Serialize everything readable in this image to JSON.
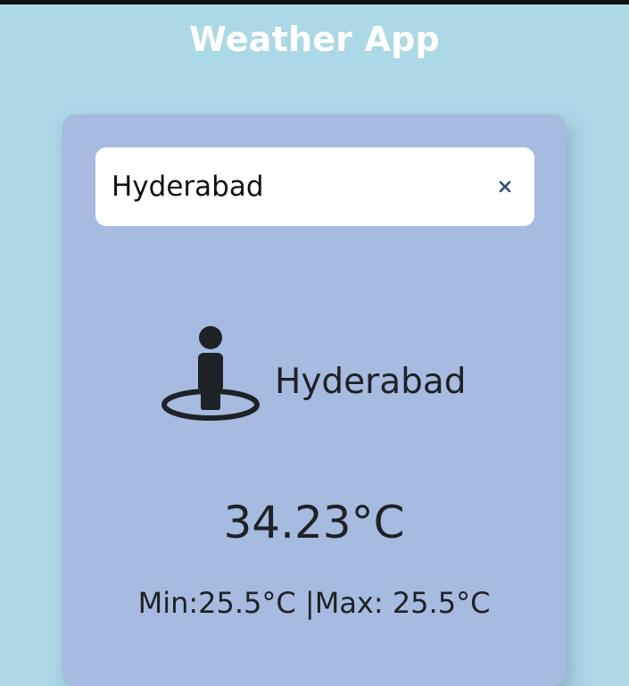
{
  "app": {
    "title": "Weather App"
  },
  "search": {
    "value": "Hyderabad",
    "clear_icon": "close-icon"
  },
  "location": {
    "icon": "person-location-icon",
    "city": "Hyderabad"
  },
  "weather": {
    "temperature": "34.23°C",
    "minmax": "Min:25.5°C |Max: 25.5°C"
  },
  "colors": {
    "background": "#add8e6",
    "card": "#a6bbdf",
    "title": "#ffffff",
    "text": "#1e2227",
    "clear_icon": "#2d4c73"
  }
}
